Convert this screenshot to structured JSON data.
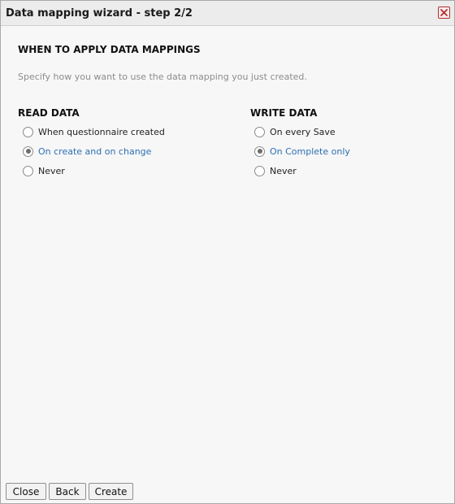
{
  "dialog": {
    "title": "Data mapping wizard - step 2/2",
    "close_icon": "close-icon"
  },
  "content": {
    "heading": "WHEN TO APPLY DATA MAPPINGS",
    "description": "Specify how you want to use the data mapping you just created."
  },
  "read_data": {
    "title": "READ DATA",
    "options": [
      {
        "label": "When questionnaire created",
        "selected": false
      },
      {
        "label": "On create and on change",
        "selected": true
      },
      {
        "label": "Never",
        "selected": false
      }
    ]
  },
  "write_data": {
    "title": "WRITE DATA",
    "options": [
      {
        "label": "On every Save",
        "selected": false
      },
      {
        "label": "On Complete only",
        "selected": true
      },
      {
        "label": "Never",
        "selected": false
      }
    ]
  },
  "buttons": {
    "close": "Close",
    "back": "Back",
    "create": "Create"
  },
  "colors": {
    "selected_text": "#2d6fb2",
    "close_icon": "#b03030"
  }
}
